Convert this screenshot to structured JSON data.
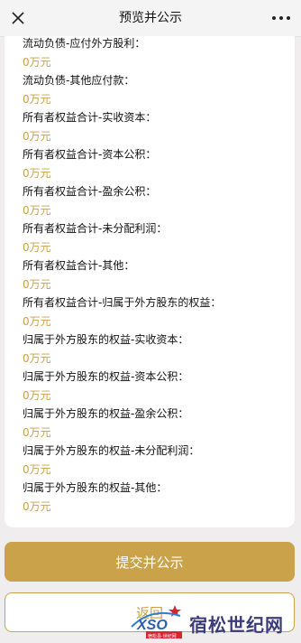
{
  "header": {
    "title": "预览并公示",
    "close_icon": "close-icon",
    "more_icon": "more-dots-icon"
  },
  "fields": [
    {
      "label": "流动负债-应付外方股利：",
      "value": "0万元"
    },
    {
      "label": "流动负债-其他应付款：",
      "value": "0万元"
    },
    {
      "label": "所有者权益合计-实收资本：",
      "value": "0万元"
    },
    {
      "label": "所有者权益合计-资本公积：",
      "value": "0万元"
    },
    {
      "label": "所有者权益合计-盈余公积：",
      "value": "0万元"
    },
    {
      "label": "所有者权益合计-未分配利润：",
      "value": "0万元"
    },
    {
      "label": "所有者权益合计-其他：",
      "value": "0万元"
    },
    {
      "label": "所有者权益合计-归属于外方股东的权益：",
      "value": "0万元"
    },
    {
      "label": "归属于外方股东的权益-实收资本：",
      "value": "0万元"
    },
    {
      "label": "归属于外方股东的权益-资本公积：",
      "value": "0万元"
    },
    {
      "label": "归属于外方股东的权益-盈余公积：",
      "value": "0万元"
    },
    {
      "label": "归属于外方股东的权益-未分配利润：",
      "value": "0万元"
    },
    {
      "label": "归属于外方股东的权益-其他：",
      "value": "0万元"
    }
  ],
  "actions": {
    "submit_label": "提交并公示",
    "back_label": "返回"
  },
  "watermark": {
    "logo_text": "XSO",
    "logo_subtext": "宿松县·世纪网",
    "text": "宿松世纪网"
  },
  "colors": {
    "accent": "#c9a24a",
    "value_text": "#c8a04a",
    "background": "#efeded",
    "card": "#ffffff"
  }
}
